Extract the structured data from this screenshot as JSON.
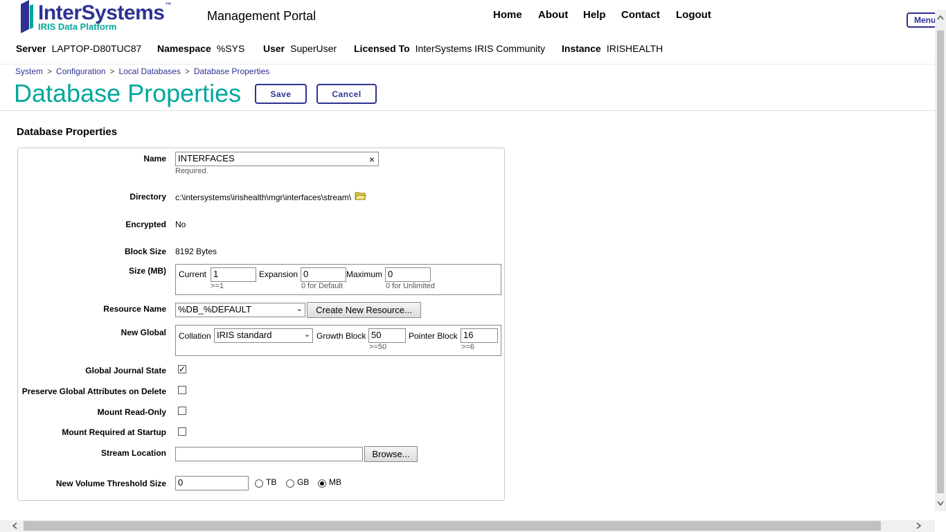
{
  "header": {
    "logo_text": "InterSystems",
    "logo_tm": "™",
    "logo_sub": "IRIS Data Platform",
    "portal_title": "Management Portal",
    "nav": [
      "Home",
      "About",
      "Help",
      "Contact",
      "Logout"
    ],
    "menu_label": "Menu",
    "info": {
      "server_label": "Server",
      "server": "LAPTOP-D80TUC87",
      "namespace_label": "Namespace",
      "namespace": "%SYS",
      "user_label": "User",
      "user": "SuperUser",
      "licensed_label": "Licensed To",
      "licensed": "InterSystems IRIS Community",
      "instance_label": "Instance",
      "instance": "IRISHEALTH"
    }
  },
  "breadcrumb": [
    "System",
    "Configuration",
    "Local Databases",
    "Database Properties"
  ],
  "page_title": "Database Properties",
  "buttons": {
    "save": "Save",
    "cancel": "Cancel"
  },
  "section_title": "Database Properties",
  "form": {
    "name_label": "Name",
    "name_value": "INTERFACES",
    "name_hint": "Required.",
    "clear_glyph": "×",
    "directory_label": "Directory",
    "directory_value": "c:\\intersystems\\irishealth\\mgr\\interfaces\\stream\\",
    "encrypted_label": "Encrypted",
    "encrypted_value": "No",
    "block_size_label": "Block Size",
    "block_size_value": "8192 Bytes",
    "size_label": "Size (MB)",
    "current_label": "Current",
    "current_value": "1",
    "current_hint": ">=1",
    "expansion_label": "Expansion",
    "expansion_value": "0",
    "expansion_hint": "0 for Default",
    "maximum_label": "Maximum",
    "maximum_value": "0",
    "maximum_hint": "0 for Unlimited",
    "resource_label": "Resource Name",
    "resource_value": "%DB_%DEFAULT",
    "create_resource": "Create New Resource...",
    "new_global_label": "New Global",
    "collation_label": "Collation",
    "collation_value": "IRIS standard",
    "growth_label": "Growth Block",
    "growth_value": "50",
    "growth_hint": ">=50",
    "pointer_label": "Pointer Block",
    "pointer_value": "16",
    "pointer_hint": ">=6",
    "journal_label": "Global Journal State",
    "journal_checked": true,
    "preserve_label": "Preserve Global Attributes on Delete",
    "preserve_checked": false,
    "readonly_label": "Mount Read-Only",
    "readonly_checked": false,
    "startup_label": "Mount Required at Startup",
    "startup_checked": false,
    "stream_label": "Stream Location",
    "stream_value": "",
    "browse": "Browse...",
    "threshold_label": "New Volume Threshold Size",
    "threshold_value": "0",
    "units": [
      "TB",
      "GB",
      "MB"
    ],
    "unit_selected": "MB",
    "check_glyph": "✓",
    "arrow_glyph": "⌄"
  },
  "colors": {
    "brand": "#2e3192",
    "accent": "#00a79d"
  }
}
